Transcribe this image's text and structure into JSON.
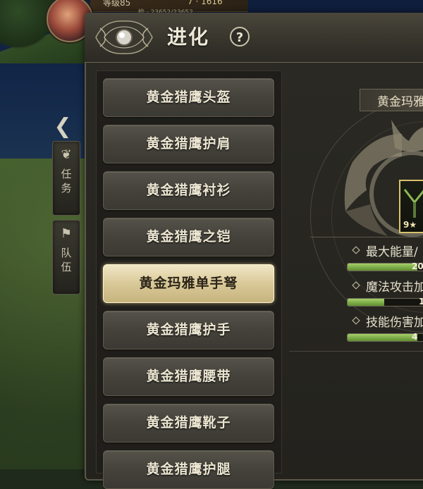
{
  "hud": {
    "level_text": "等级85",
    "power_text": "7 · 1616",
    "exp_text": "检 · 23652/23652"
  },
  "side": {
    "quest_label": "任\n务",
    "team_label": "队\n伍"
  },
  "window": {
    "title": "进化",
    "help_label": "?"
  },
  "equipment_list": [
    {
      "label": "黄金猎鹰头盔",
      "selected": false
    },
    {
      "label": "黄金猎鹰护肩",
      "selected": false
    },
    {
      "label": "黄金猎鹰衬衫",
      "selected": false
    },
    {
      "label": "黄金猎鹰之铠",
      "selected": false
    },
    {
      "label": "黄金玛雅单手弩",
      "selected": true
    },
    {
      "label": "黄金猎鹰护手",
      "selected": false
    },
    {
      "label": "黄金猎鹰腰带",
      "selected": false
    },
    {
      "label": "黄金猎鹰靴子",
      "selected": false
    },
    {
      "label": "黄金猎鹰护腿",
      "selected": false
    }
  ],
  "detail": {
    "item_name": "黄金玛雅",
    "item_stars": "9★",
    "stats": [
      {
        "label": "最大能量/",
        "value_text": "20",
        "fill": 0.85
      },
      {
        "label": "魔法攻击加",
        "value_text": "1",
        "fill": 0.45
      },
      {
        "label": "技能伤害加",
        "value_text": "4",
        "fill": 0.85
      }
    ]
  },
  "colors": {
    "panel": "#2b2a24",
    "selected_item": "#d9c998",
    "bar_fill": "#7fae45",
    "title_text": "#eee8d8"
  }
}
